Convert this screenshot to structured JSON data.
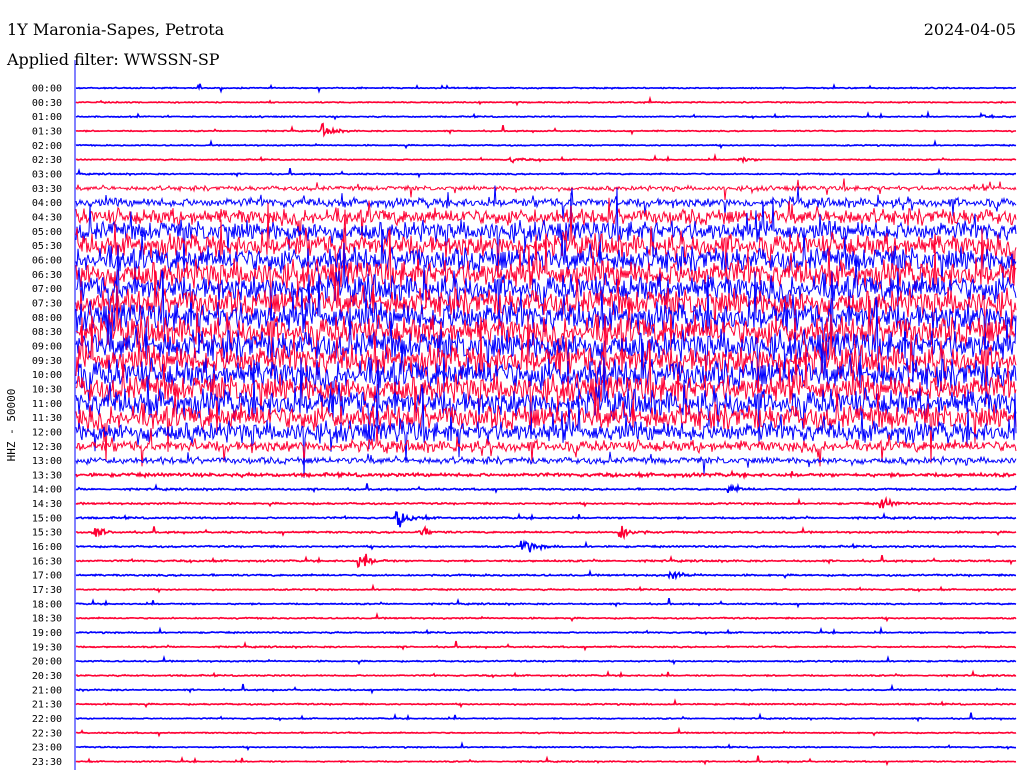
{
  "header": {
    "title": "1Y Maronia-Sapes, Petrota",
    "date": "2024-04-05",
    "filter": "Applied filter: WWSSN-SP"
  },
  "chart_data": {
    "type": "line",
    "title": "1Y Maronia-Sapes, Petrota",
    "ylabel": "HHZ - 50000",
    "x_range_minutes": [
      0,
      30
    ],
    "colors": [
      "#0000ff",
      "#ff0033"
    ],
    "rows": [
      "00:00",
      "00:30",
      "01:00",
      "01:30",
      "02:00",
      "02:30",
      "03:00",
      "03:30",
      "04:00",
      "04:30",
      "05:00",
      "05:30",
      "06:00",
      "06:30",
      "07:00",
      "07:30",
      "08:00",
      "08:30",
      "09:00",
      "09:30",
      "10:00",
      "10:30",
      "11:00",
      "11:30",
      "12:00",
      "12:30",
      "13:00",
      "13:30",
      "14:00",
      "14:30",
      "15:00",
      "15:30",
      "16:00",
      "16:30",
      "17:00",
      "17:30",
      "18:00",
      "18:30",
      "19:00",
      "19:30",
      "20:00",
      "20:30",
      "21:00",
      "21:30",
      "22:00",
      "22:30",
      "23:00",
      "23:30"
    ],
    "noise_level": [
      1,
      1,
      1,
      1,
      1,
      1,
      1.2,
      4,
      8,
      14,
      18,
      20,
      22,
      24,
      24,
      24,
      26,
      26,
      26,
      26,
      26,
      24,
      24,
      22,
      18,
      10,
      6,
      3,
      1.5,
      1.5,
      1.5,
      1.5,
      1.5,
      1.5,
      1.5,
      1.2,
      1.2,
      1.2,
      1.2,
      1.2,
      1.2,
      1.2,
      1.2,
      1.2,
      1,
      1,
      1,
      1
    ],
    "events": [
      {
        "row": "01:00",
        "minute": 28.9,
        "amplitude": 6
      },
      {
        "row": "01:30",
        "minute": 7.9,
        "amplitude": 9
      },
      {
        "row": "02:30",
        "minute": 13.9,
        "amplitude": 4
      },
      {
        "row": "02:30",
        "minute": 21.2,
        "amplitude": 4
      },
      {
        "row": "12:00",
        "minute": 10.3,
        "amplitude": 10
      },
      {
        "row": "14:00",
        "minute": 20.9,
        "amplitude": 6
      },
      {
        "row": "14:30",
        "minute": 25.7,
        "amplitude": 10
      },
      {
        "row": "15:00",
        "minute": 10.3,
        "amplitude": 12
      },
      {
        "row": "15:30",
        "minute": 0.6,
        "amplitude": 7
      },
      {
        "row": "15:30",
        "minute": 11.0,
        "amplitude": 7
      },
      {
        "row": "15:30",
        "minute": 17.4,
        "amplitude": 12
      },
      {
        "row": "16:00",
        "minute": 14.3,
        "amplitude": 12
      },
      {
        "row": "16:30",
        "minute": 9.1,
        "amplitude": 12
      },
      {
        "row": "17:00",
        "minute": 19.0,
        "amplitude": 6
      }
    ]
  }
}
